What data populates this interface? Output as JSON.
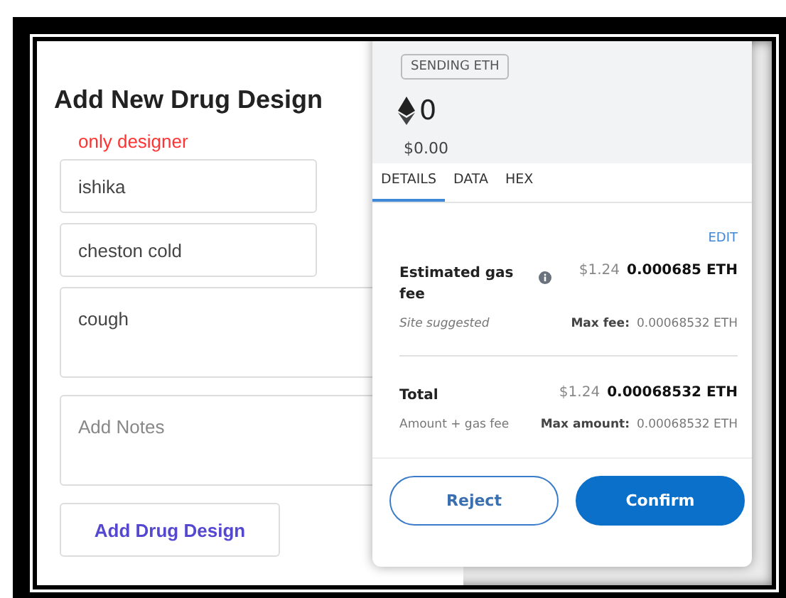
{
  "form": {
    "title": "Add New Drug Design",
    "notice": "only designer",
    "fields": [
      {
        "kind": "input",
        "value": "ishika"
      },
      {
        "kind": "input",
        "value": "cheston cold"
      },
      {
        "kind": "textarea",
        "value": "cough"
      },
      {
        "kind": "textarea",
        "placeholder": "Add Notes"
      }
    ],
    "submit": "Add Drug Design"
  },
  "popup": {
    "badge": "SENDING ETH",
    "amount": "0",
    "fiat": "$0.00",
    "tabs": [
      {
        "label": "DETAILS",
        "selected": true
      },
      {
        "label": "DATA",
        "selected": false
      },
      {
        "label": "HEX",
        "selected": false
      }
    ],
    "edit": "EDIT",
    "gas": {
      "label": "Estimated gas fee",
      "fiat": "$1.24",
      "eth": "0.000685 ETH",
      "note": "Site suggested",
      "max_label": "Max fee:",
      "max_value": "0.00068532 ETH"
    },
    "total": {
      "label": "Total",
      "fiat": "$1.24",
      "eth": "0.00068532 ETH",
      "note": "Amount + gas fee",
      "max_label": "Max amount:",
      "max_value": "0.00068532 ETH"
    },
    "buttons": [
      {
        "kind": "secondary",
        "label": "Reject"
      },
      {
        "kind": "primary",
        "label": "Confirm"
      }
    ]
  }
}
